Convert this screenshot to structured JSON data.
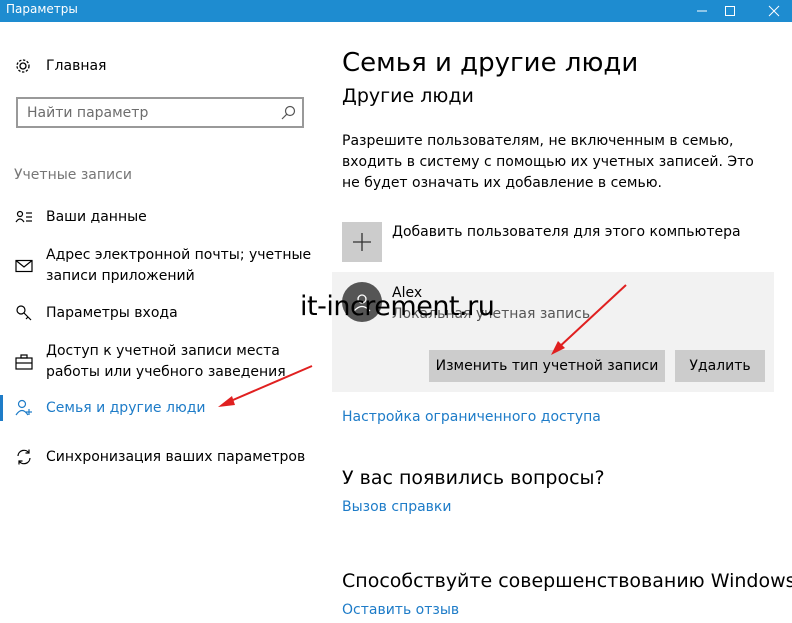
{
  "window": {
    "title": "Параметры",
    "controls": [
      "minimize-icon",
      "maximize-icon",
      "close-icon"
    ],
    "titlebar_color": "#1e8cd0"
  },
  "sidebar": {
    "home_label": "Главная",
    "search_placeholder": "Найти параметр",
    "section_title": "Учетные записи",
    "items": [
      {
        "label": "Ваши данные",
        "icon": "person-card-icon"
      },
      {
        "label": "Адрес электронной почты; учетные записи приложений",
        "icon": "mail-icon"
      },
      {
        "label": "Параметры входа",
        "icon": "key-icon"
      },
      {
        "label": "Доступ к учетной записи места работы или учебного заведения",
        "icon": "briefcase-icon"
      },
      {
        "label": "Семья и другие люди",
        "icon": "person-add-icon",
        "active": true
      },
      {
        "label": "Синхронизация ваших параметров",
        "icon": "sync-icon"
      }
    ]
  },
  "main": {
    "title": "Семья и другие люди",
    "subtitle": "Другие люди",
    "description": "Разрешите пользователям, не включенным в семью, входить в систему с помощью их учетных записей. Это не будет означать их добавление в семью.",
    "add_user_label": "Добавить пользователя для этого компьютера",
    "user": {
      "name": "Alex",
      "type": "Локальная учетная запись"
    },
    "buttons": {
      "change_type": "Изменить тип учетной записи",
      "delete": "Удалить"
    },
    "restricted_access_link": "Настройка ограниченного доступа",
    "questions_title": "У вас появились вопросы?",
    "help_link": "Вызов справки",
    "improve_title": "Способствуйте совершенствованию Windows.",
    "feedback_link": "Оставить отзыв"
  },
  "watermark": "it-increment.ru",
  "colors": {
    "accent": "#1e7cc8",
    "annotation_arrow": "#e02020",
    "button_bg": "#cccccc",
    "card_bg": "#f2f2f2"
  }
}
